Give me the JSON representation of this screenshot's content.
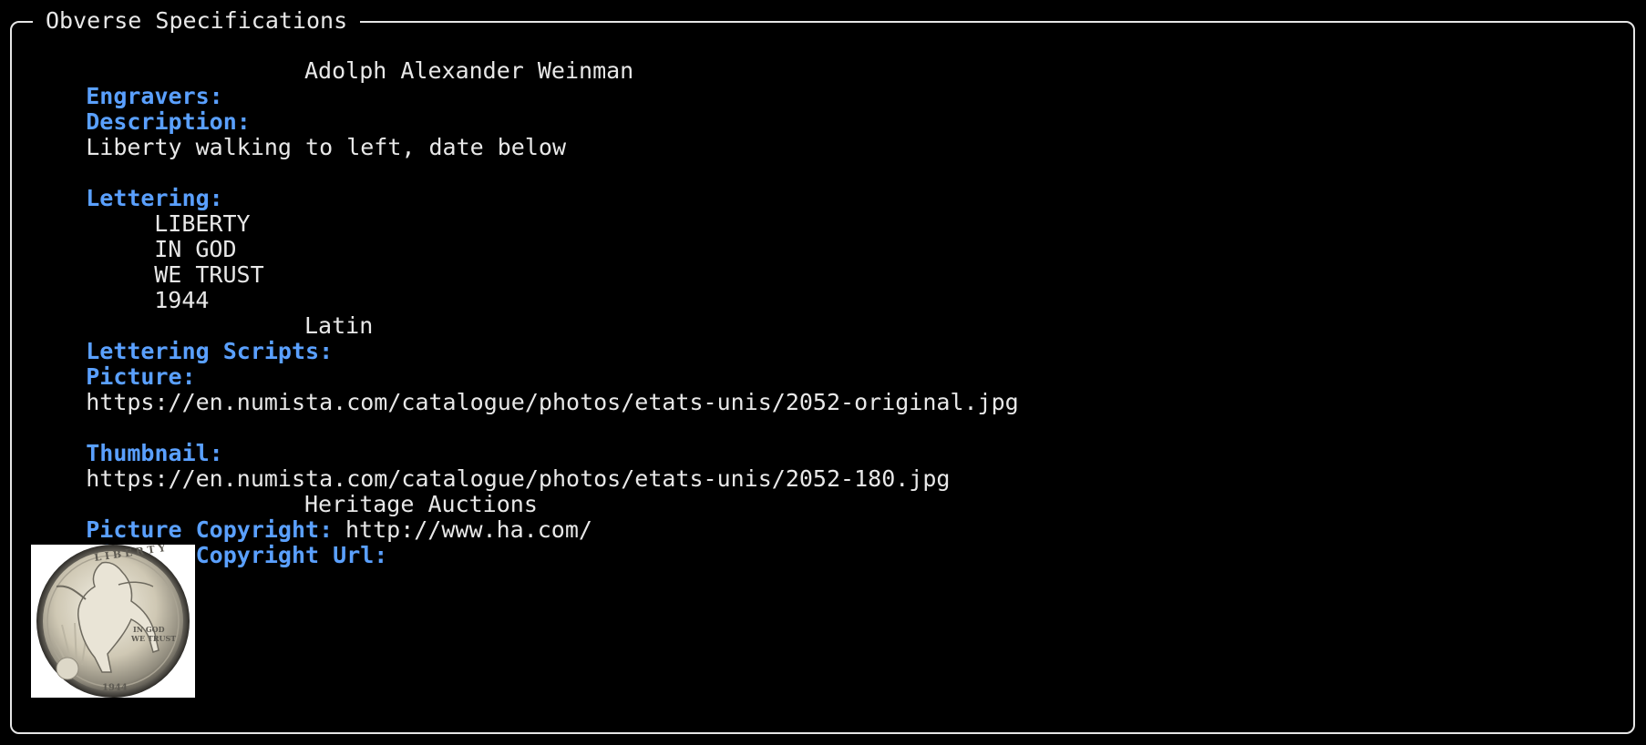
{
  "panel": {
    "title": "Obverse Specifications"
  },
  "fields": {
    "engravers": {
      "label": "Engravers:",
      "value": "Adolph Alexander Weinman"
    },
    "description": {
      "label": "Description:",
      "value": "Liberty walking to left, date below"
    },
    "lettering": {
      "label": "Lettering:",
      "lines": [
        "LIBERTY",
        "IN GOD",
        "WE TRUST",
        "1944"
      ]
    },
    "lettering_scripts": {
      "label": "Lettering Scripts:",
      "value": "Latin"
    },
    "picture": {
      "label": "Picture:",
      "value": "https://en.numista.com/catalogue/photos/etats-unis/2052-original.jpg"
    },
    "thumbnail": {
      "label": "Thumbnail:",
      "value": "https://en.numista.com/catalogue/photos/etats-unis/2052-180.jpg"
    },
    "picture_copyright": {
      "label": "Picture Copyright:",
      "value": "Heritage Auctions"
    },
    "picture_copyright_url": {
      "label": "Picture Copyright Url:",
      "value": "http://www.ha.com/"
    }
  },
  "coin_image": {
    "icon": "walking-liberty-half-dollar-obverse",
    "legend_top": "LIBERTY",
    "motto": "IN GOD WE TRUST",
    "date": "1944"
  },
  "colors": {
    "background": "#000000",
    "label": "#5aa0ff",
    "text": "#e8e8e8",
    "border": "#e6e6e6"
  }
}
